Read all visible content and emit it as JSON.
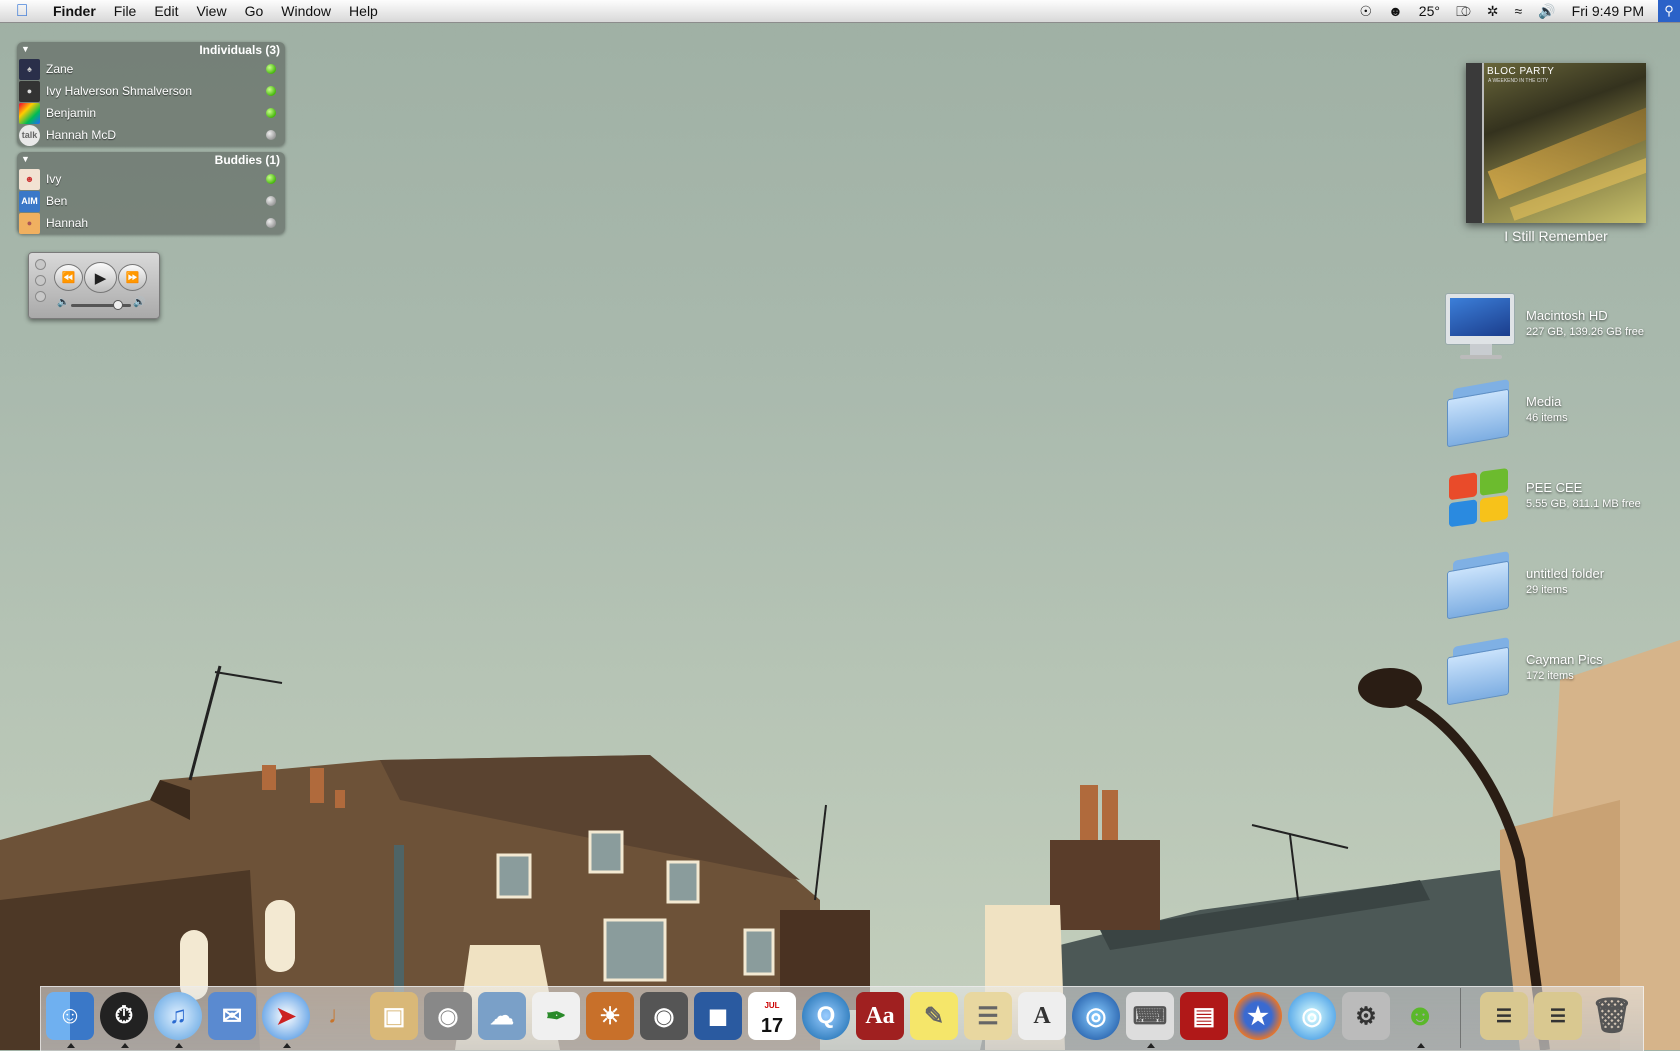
{
  "menubar": {
    "apple": "",
    "app_name": "Finder",
    "menus": [
      "File",
      "Edit",
      "View",
      "Go",
      "Window",
      "Help"
    ],
    "temperature": "25°",
    "clock": "Fri 9:49 PM"
  },
  "buddy_lists": [
    {
      "title": "Individuals (3)",
      "buddies": [
        {
          "name": "Zane",
          "status": "online"
        },
        {
          "name": "Ivy Halverson Shmalverson",
          "status": "online"
        },
        {
          "name": "Benjamin",
          "status": "online"
        },
        {
          "name": "Hannah McD",
          "status": "offline"
        }
      ]
    },
    {
      "title": "Buddies (1)",
      "buddies": [
        {
          "name": "Ivy",
          "status": "online"
        },
        {
          "name": "Ben",
          "status": "offline"
        },
        {
          "name": "Hannah",
          "status": "offline"
        }
      ]
    }
  ],
  "avatar_texts": {
    "hannah_mcd": "talk",
    "ben": "AIM"
  },
  "now_playing": {
    "album_art_title": "BLOC PARTY",
    "album_art_subtitle": "A WEEKEND IN THE CITY",
    "track": "I Still Remember"
  },
  "desktop_icons": [
    {
      "name": "Macintosh HD",
      "info": "227 GB, 139.26 GB free",
      "icon": "imac-icon"
    },
    {
      "name": "Media",
      "info": "46 items",
      "icon": "folder-icon"
    },
    {
      "name": "PEE CEE",
      "info": "5.55 GB, 811.1 MB free",
      "icon": "windows-drive-icon"
    },
    {
      "name": "untitled folder",
      "info": "29 items",
      "icon": "folder-icon"
    },
    {
      "name": "Cayman Pics",
      "info": "172 items",
      "icon": "folder-icon"
    }
  ],
  "dock": {
    "calendar_month": "JUL",
    "calendar_day": "17",
    "dictionary_glyph": "Aa",
    "apps": [
      "Finder",
      "Dashboard",
      "iTunes",
      "Mail",
      "Safari",
      "GarageBand",
      "Preview",
      "Image Capture",
      "iPhoto",
      "Pages",
      "Aperture",
      "Photo Booth",
      "iMovie",
      "iCal",
      "QuickTime",
      "Dictionary",
      "Stickies",
      "TextEdit",
      "Font Book",
      "Google Earth",
      "System Profiler",
      "Front Row",
      "Firefox",
      "Network",
      "System Preferences",
      "Adium"
    ]
  },
  "colors": {
    "accent": "#2b62c8",
    "online": "#47b80d",
    "offline": "#9a9a9a"
  }
}
